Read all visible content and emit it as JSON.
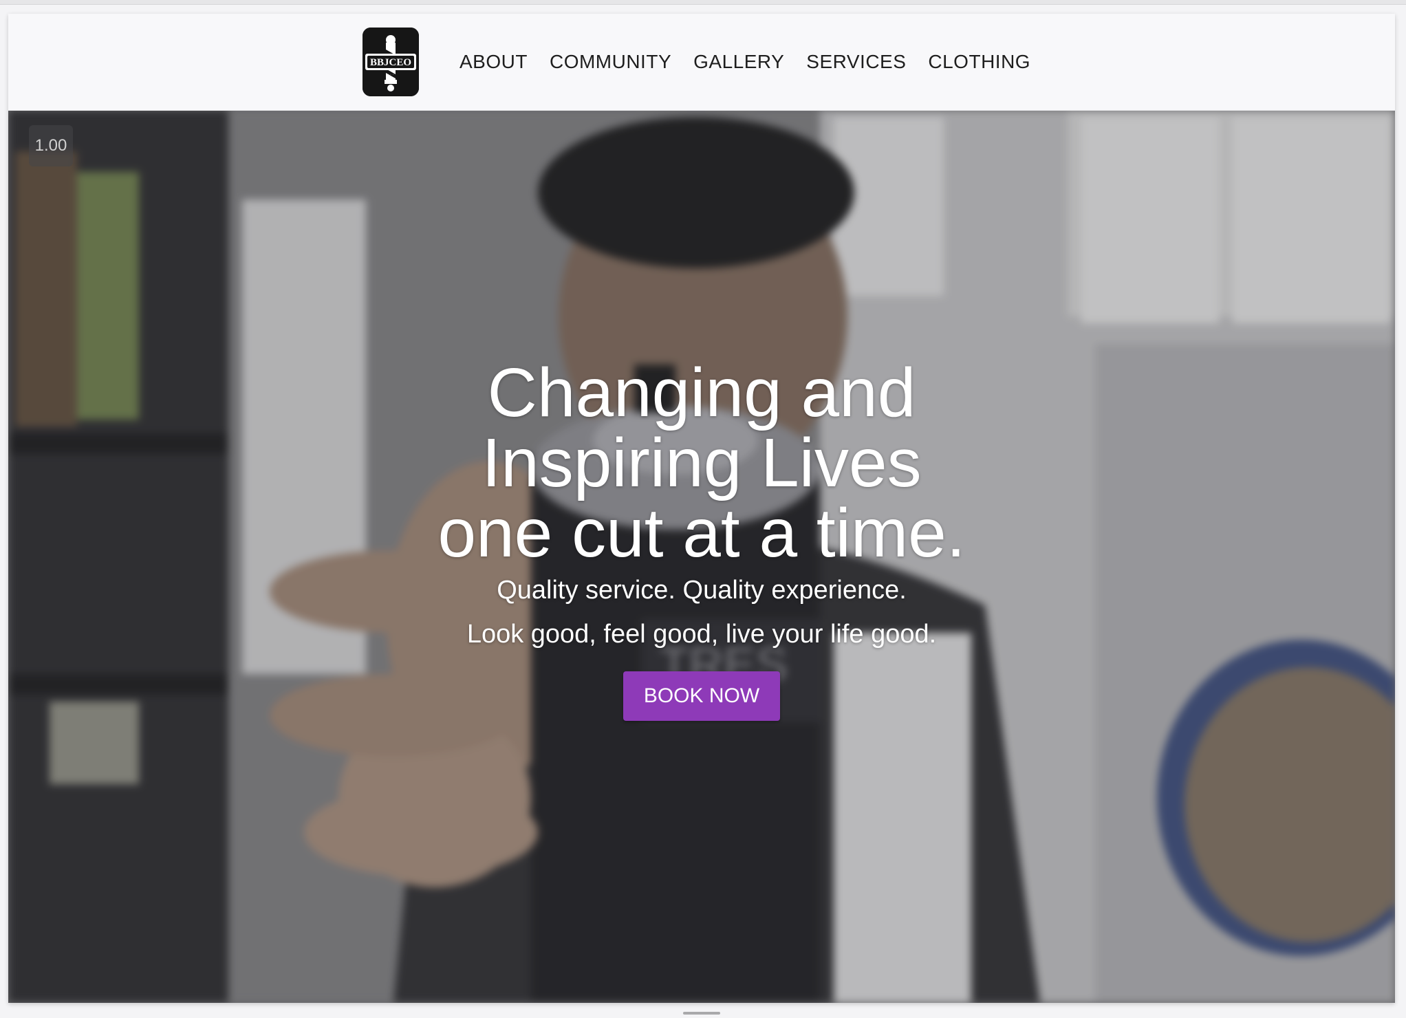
{
  "header": {
    "logo": {
      "icon": "barber-pole-logo-icon",
      "text": "BBJCEO",
      "background": "#161616"
    },
    "nav": [
      {
        "label": "ABOUT"
      },
      {
        "label": "COMMUNITY"
      },
      {
        "label": "GALLERY"
      },
      {
        "label": "SERVICES"
      },
      {
        "label": "CLOTHING"
      }
    ]
  },
  "hero": {
    "playback_speed": "1.00",
    "headline_lines": [
      "Changing and",
      "Inspiring Lives",
      "one cut at a time."
    ],
    "sublines": [
      "Quality service. Quality experience.",
      "Look good, feel good, live your life good."
    ],
    "cta_label": "BOOK NOW",
    "cta_color": "#8e3ab8",
    "background_video": "barber holding hairspray can"
  }
}
